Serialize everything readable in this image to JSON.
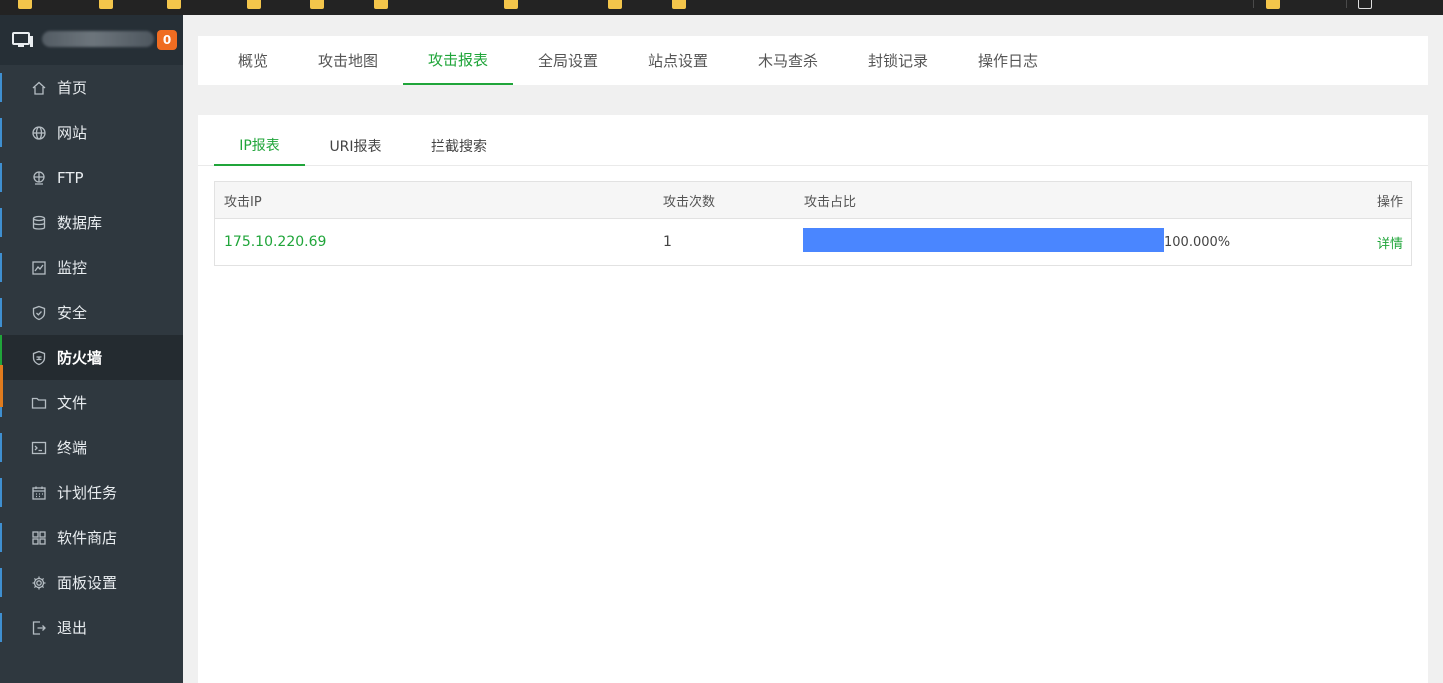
{
  "sidebar": {
    "notice_count": "0",
    "items": [
      {
        "label": "首页",
        "icon": "home-icon"
      },
      {
        "label": "网站",
        "icon": "globe-icon"
      },
      {
        "label": "FTP",
        "icon": "ftp-icon"
      },
      {
        "label": "数据库",
        "icon": "database-icon"
      },
      {
        "label": "监控",
        "icon": "monitor-icon"
      },
      {
        "label": "安全",
        "icon": "shield-icon"
      },
      {
        "label": "防火墙",
        "icon": "firewall-icon"
      },
      {
        "label": "文件",
        "icon": "folder-icon"
      },
      {
        "label": "终端",
        "icon": "terminal-icon"
      },
      {
        "label": "计划任务",
        "icon": "calendar-icon"
      },
      {
        "label": "软件商店",
        "icon": "apps-icon"
      },
      {
        "label": "面板设置",
        "icon": "gear-icon"
      },
      {
        "label": "退出",
        "icon": "logout-icon"
      }
    ],
    "active_item": "防火墙"
  },
  "tabs": {
    "items": [
      "概览",
      "攻击地图",
      "攻击报表",
      "全局设置",
      "站点设置",
      "木马查杀",
      "封锁记录",
      "操作日志"
    ],
    "active": "攻击报表"
  },
  "report": {
    "subtabs": [
      "IP报表",
      "URI报表",
      "拦截搜索"
    ],
    "active_subtab": "IP报表",
    "columns": {
      "ip": "攻击IP",
      "count": "攻击次数",
      "ratio": "攻击占比",
      "action": "操作"
    },
    "rows": [
      {
        "ip": "175.10.220.69",
        "count": "1",
        "ratio_text": "100.000%",
        "ratio": 1.0,
        "action": "详情"
      }
    ]
  },
  "colors": {
    "accent": "#20a53a",
    "bar": "#4a86ff",
    "sidebar": "#2f383f",
    "badge": "#ef6c21"
  }
}
